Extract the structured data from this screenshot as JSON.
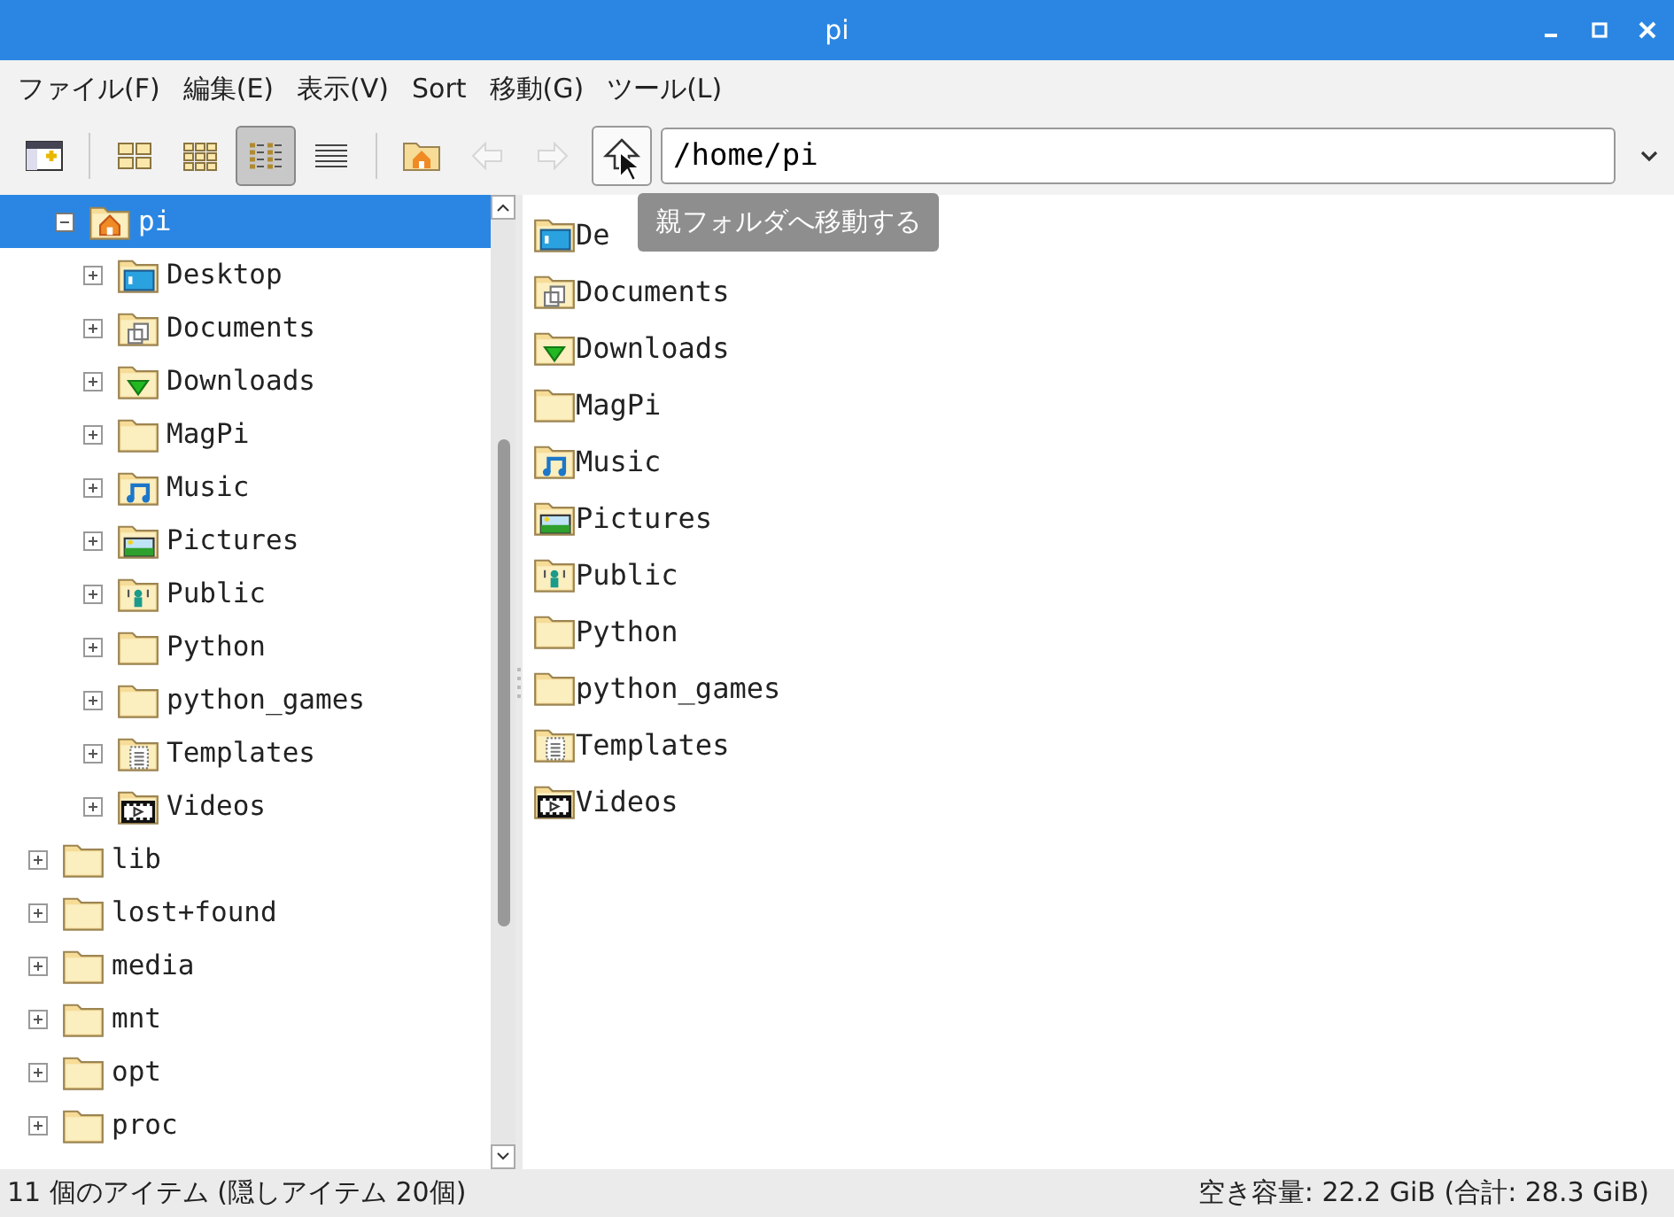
{
  "window": {
    "title": "pi"
  },
  "menu": [
    "ファイル(F)",
    "編集(E)",
    "表示(V)",
    "Sort",
    "移動(G)",
    "ツール(L)"
  ],
  "toolbar": {
    "views": [
      {
        "kind": "icons",
        "selected": false
      },
      {
        "kind": "thumbnails",
        "selected": false
      },
      {
        "kind": "compact",
        "selected": true
      },
      {
        "kind": "list",
        "selected": false
      }
    ],
    "back_disabled": true,
    "forward_disabled": true,
    "path": "/home/pi",
    "tooltip": "親フォルダへ移動する"
  },
  "tree": {
    "branch": [
      {
        "label": "pi",
        "kind": "home",
        "expanded": true,
        "selected": true,
        "children": [
          {
            "label": "Desktop",
            "kind": "desktop",
            "expanded": false,
            "selected": false
          },
          {
            "label": "Documents",
            "kind": "documents",
            "expanded": false,
            "selected": false
          },
          {
            "label": "Downloads",
            "kind": "downloads",
            "expanded": false,
            "selected": false
          },
          {
            "label": "MagPi",
            "kind": "plain",
            "expanded": false,
            "selected": false
          },
          {
            "label": "Music",
            "kind": "music",
            "expanded": false,
            "selected": false
          },
          {
            "label": "Pictures",
            "kind": "pictures",
            "expanded": false,
            "selected": false
          },
          {
            "label": "Public",
            "kind": "public",
            "expanded": false,
            "selected": false
          },
          {
            "label": "Python",
            "kind": "plain",
            "expanded": false,
            "selected": false
          },
          {
            "label": "python_games",
            "kind": "plain",
            "expanded": false,
            "selected": false
          },
          {
            "label": "Templates",
            "kind": "templates",
            "expanded": false,
            "selected": false
          },
          {
            "label": "Videos",
            "kind": "videos",
            "expanded": false,
            "selected": false
          }
        ]
      }
    ],
    "items": [
      {
        "label": "lib",
        "expanded": false,
        "selected": false
      },
      {
        "label": "lost+found",
        "expanded": false,
        "selected": false
      },
      {
        "label": "media",
        "expanded": false,
        "selected": false
      },
      {
        "label": "mnt",
        "expanded": false,
        "selected": false
      },
      {
        "label": "opt",
        "expanded": false,
        "selected": false
      },
      {
        "label": "proc",
        "expanded": false,
        "selected": false
      }
    ]
  },
  "files": [
    {
      "name": "De",
      "kind": "desktop"
    },
    {
      "name": "Documents",
      "kind": "documents"
    },
    {
      "name": "Downloads",
      "kind": "downloads"
    },
    {
      "name": "MagPi",
      "kind": "plain"
    },
    {
      "name": "Music",
      "kind": "music"
    },
    {
      "name": "Pictures",
      "kind": "pictures"
    },
    {
      "name": "Public",
      "kind": "public"
    },
    {
      "name": "Python",
      "kind": "plain"
    },
    {
      "name": "python_games",
      "kind": "plain"
    },
    {
      "name": "Templates",
      "kind": "templates"
    },
    {
      "name": "Videos",
      "kind": "videos"
    }
  ],
  "status_bar": {
    "count": "11 個のアイテム (隠しアイテム 20個)",
    "free_space": "空き容量: 22.2 GiB (合計: 28.3 GiB)"
  }
}
